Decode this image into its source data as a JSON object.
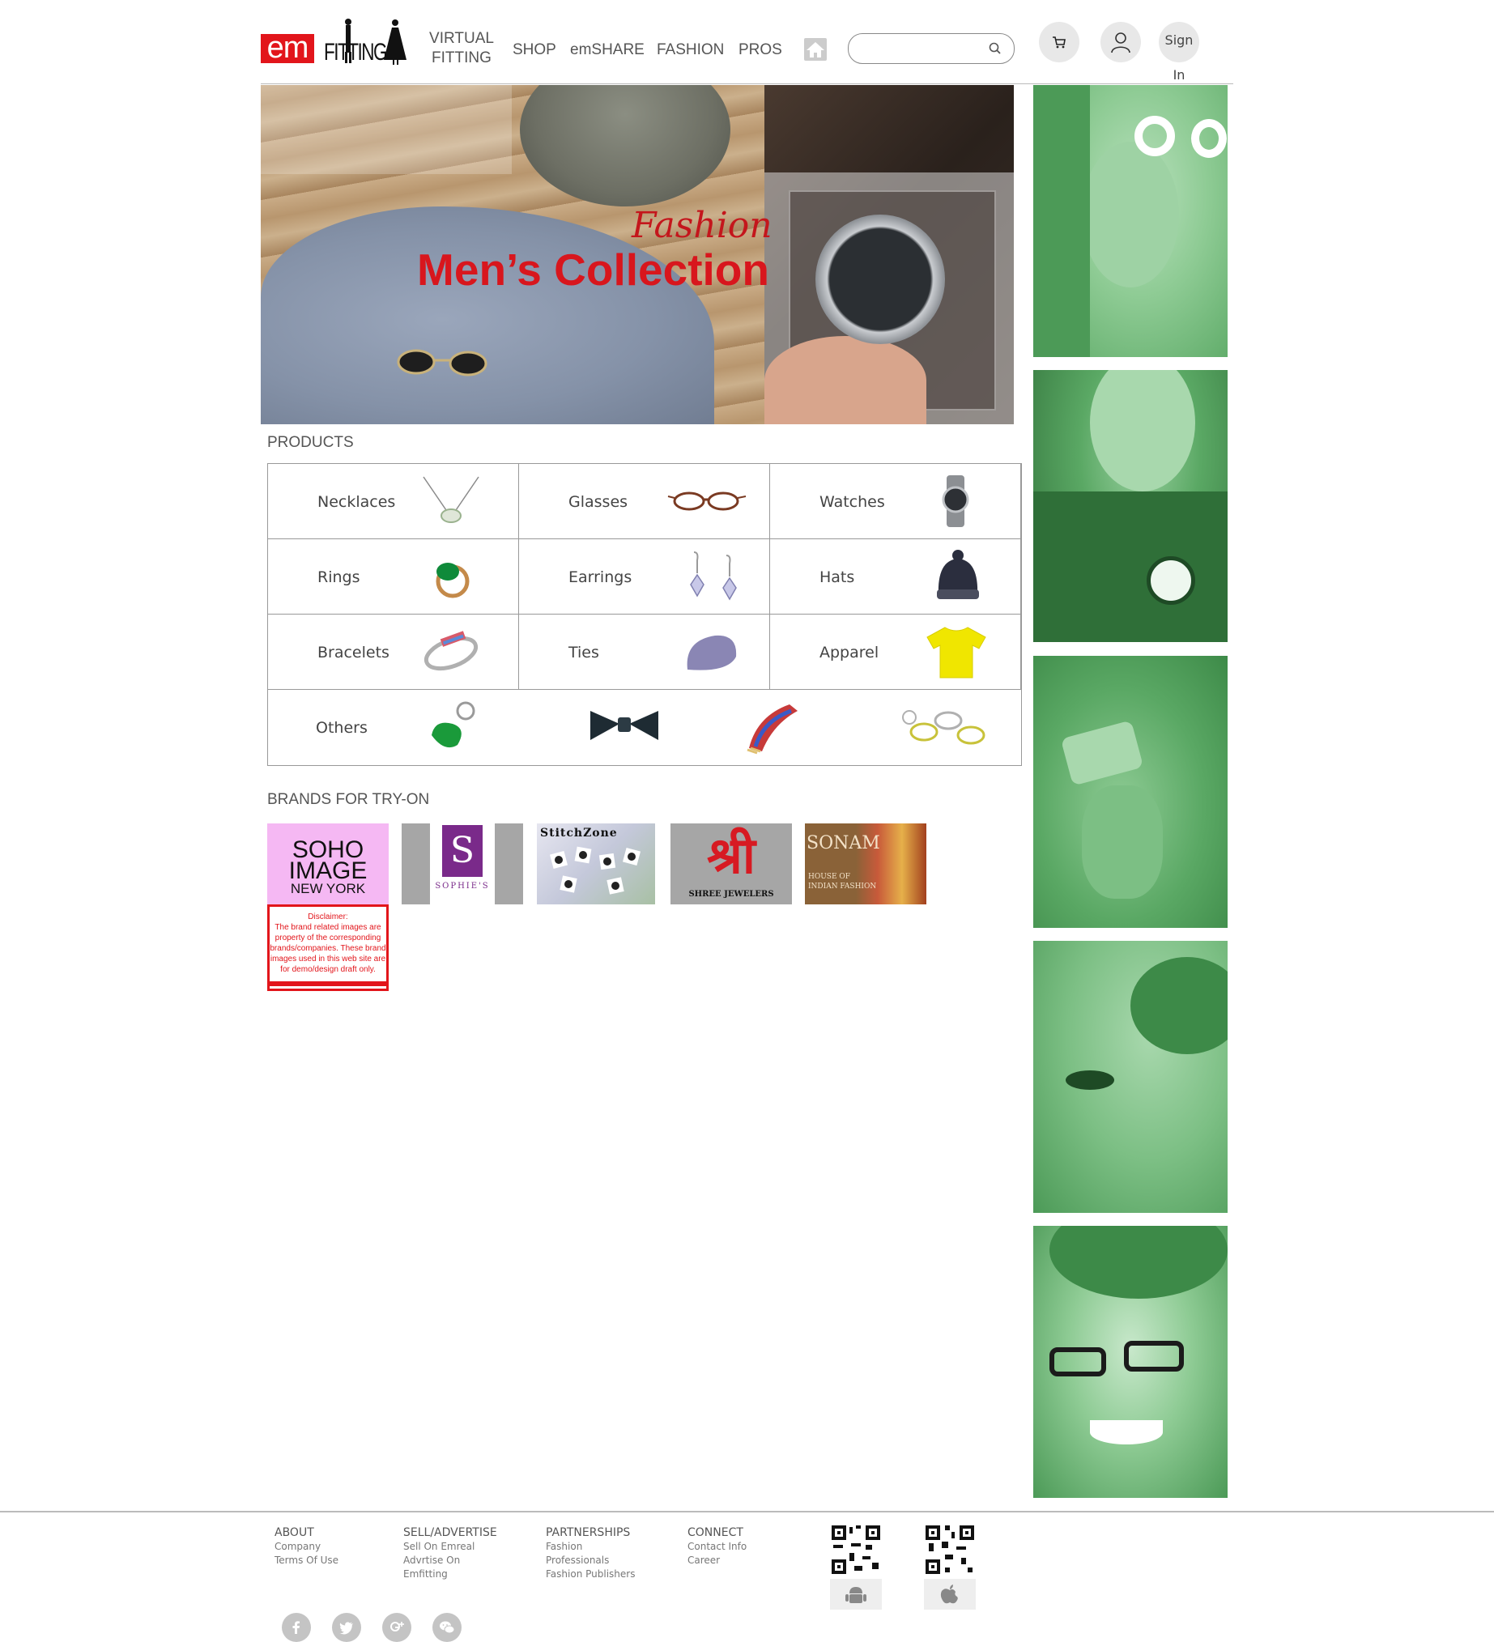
{
  "header": {
    "logo": {
      "em": "em",
      "fitting": "FITTING"
    },
    "nav": {
      "virtual_fitting": [
        "VIRTUAL",
        "FITTING"
      ],
      "shop": "SHOP",
      "emshare": "emSHARE",
      "fashion": "FASHION",
      "pros": "PROS"
    },
    "search": {
      "placeholder": ""
    },
    "sign_in": [
      "Sign",
      "In"
    ]
  },
  "hero": {
    "script_title": "Fashion",
    "title": "Men’s Collection"
  },
  "products": {
    "title": "PRODUCTS",
    "items": [
      {
        "label": "Necklaces",
        "icon": "necklace-icon"
      },
      {
        "label": "Glasses",
        "icon": "glasses-icon"
      },
      {
        "label": "Watches",
        "icon": "watch-icon"
      },
      {
        "label": "Rings",
        "icon": "ring-icon"
      },
      {
        "label": "Earrings",
        "icon": "earrings-icon"
      },
      {
        "label": "Hats",
        "icon": "hat-icon"
      },
      {
        "label": "Bracelets",
        "icon": "bracelet-icon"
      },
      {
        "label": "Ties",
        "icon": "tie-icon"
      },
      {
        "label": "Apparel",
        "icon": "tshirt-icon"
      }
    ],
    "others": {
      "label": "Others",
      "icons": [
        "keychain-icon",
        "bowtie-icon",
        "scarf-icon",
        "keyrings-icon"
      ]
    }
  },
  "brands": {
    "title": "BRANDS FOR TRY-ON",
    "soho": [
      "SOHO",
      "IMAGE",
      "NEW YORK"
    ],
    "sophie": {
      "initial": "S",
      "name": "SOPHIE'S"
    },
    "stitchzone": "StitchZone",
    "shree": {
      "glyph": "श्री",
      "name": "SHREE JEWELERS"
    },
    "sonam": {
      "name": "SONAM",
      "tagline": [
        "HOUSE OF",
        "INDIAN FASHION"
      ]
    },
    "disclaimer": [
      "Disclaimer:",
      "The brand related images are",
      "property of the corresponding",
      "brands/companies. These brand",
      "images used in this web site are",
      "for demo/design draft only."
    ]
  },
  "footer": {
    "about": {
      "heading": "ABOUT",
      "links": [
        "Company",
        "Terms Of Use"
      ]
    },
    "sell": {
      "heading": "SELL/ADVERTISE",
      "links": [
        "Sell On Emreal",
        "Advrtise On",
        "Emfitting"
      ]
    },
    "partnerships": {
      "heading": "PARTNERSHIPS",
      "links": [
        "Fashion",
        "Professionals",
        "Fashion Publishers"
      ]
    },
    "connect": {
      "heading": "CONNECT",
      "links": [
        "Contact Info",
        "Career"
      ]
    },
    "apps": [
      "android-icon",
      "apple-icon"
    ],
    "social": [
      "facebook-icon",
      "twitter-icon",
      "google-plus-icon",
      "wechat-icon"
    ]
  },
  "colors": {
    "brand_red": "#e2151b",
    "side_green": "#5aa864",
    "text_gray": "#555555"
  }
}
